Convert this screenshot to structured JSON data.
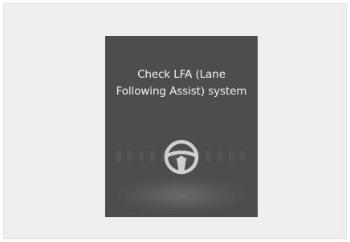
{
  "display": {
    "message_line_1": "Check LFA (Lane",
    "message_line_2": "Following Assist) system",
    "icon": "steering-wheel-icon"
  },
  "colors": {
    "screen_background": "#4d4d4d",
    "message_text": "#f2f2f2",
    "icon_color": "#d0d0d0",
    "page_background": "#efefef"
  }
}
